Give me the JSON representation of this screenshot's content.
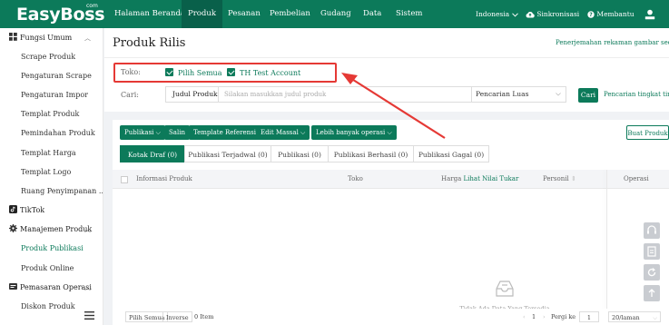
{
  "brand": {
    "name": "EasyBoss",
    "suffix": "com"
  },
  "nav": {
    "items": [
      "Halaman Beranda",
      "Produk",
      "Pesanan",
      "Pembelian",
      "Gudang",
      "Data",
      "Sistem"
    ],
    "active": "Produk",
    "language": "Indonesia",
    "sync": "Sinkronisasi",
    "help": "Membantu"
  },
  "sidebar": {
    "group1": "Fungsi Umum",
    "group1_items": [
      "Scrape Produk",
      "Pengaturan Scrape",
      "Pengaturan Impor",
      "Templat Produk",
      "Pemindahan Produk",
      "Templat Harga",
      "Templat Logo",
      "Ruang Penyimpanan ..."
    ],
    "tiktok": "TikTok",
    "group2": "Manajemen Produk",
    "group2_items": [
      "Produk Publikasi",
      "Produk Online"
    ],
    "group3": "Pemasaran Operasi",
    "group3_items": [
      "Diskon Produk"
    ]
  },
  "header": {
    "title": "Produk Rilis",
    "translate_link": "Penerjemahan rekaman gambar secara m",
    "toko_label": "Toko:",
    "select_all": "Pilih Semua",
    "account": "TH Test Account",
    "cari_label": "Cari:",
    "search_field": "Judul Produk",
    "search_placeholder": "Silakan masukkan judul produk",
    "search_mode": "Pencarian Luas",
    "cari_button": "Cari",
    "advanced_link": "Pencarian tingkat tingg"
  },
  "toolbar": {
    "publish": "Publikasi",
    "copy": "Salin",
    "template": "Template Referensi",
    "bulk_edit": "Edit Massal",
    "more": "Lebih banyak operasi",
    "create": "Buat Produk"
  },
  "tabs": [
    "Kotak Draf (0)",
    "Publikasi Terjadwal (0)",
    "Publikasi (0)",
    "Publikasi Berhasil (0)",
    "Publikasi Gagal (0)"
  ],
  "table": {
    "col_info": "Informasi Produk",
    "col_toko": "Toko",
    "col_harga": "Harga",
    "col_harga_link": "Lihat Nilai Tukar",
    "col_personil": "Personil",
    "col_operasi": "Operasi",
    "empty": "Tidak Ada Data Yang Tersedia"
  },
  "footer": {
    "select_all": "Pilih Semua",
    "inverse": "Inverse",
    "count": "0 Item",
    "page": "1",
    "goto": "Pergi ke",
    "goto_value": "1",
    "per_page": "20/laman"
  },
  "colors": {
    "primary": "#0c7a5a",
    "highlight": "#e53935"
  }
}
